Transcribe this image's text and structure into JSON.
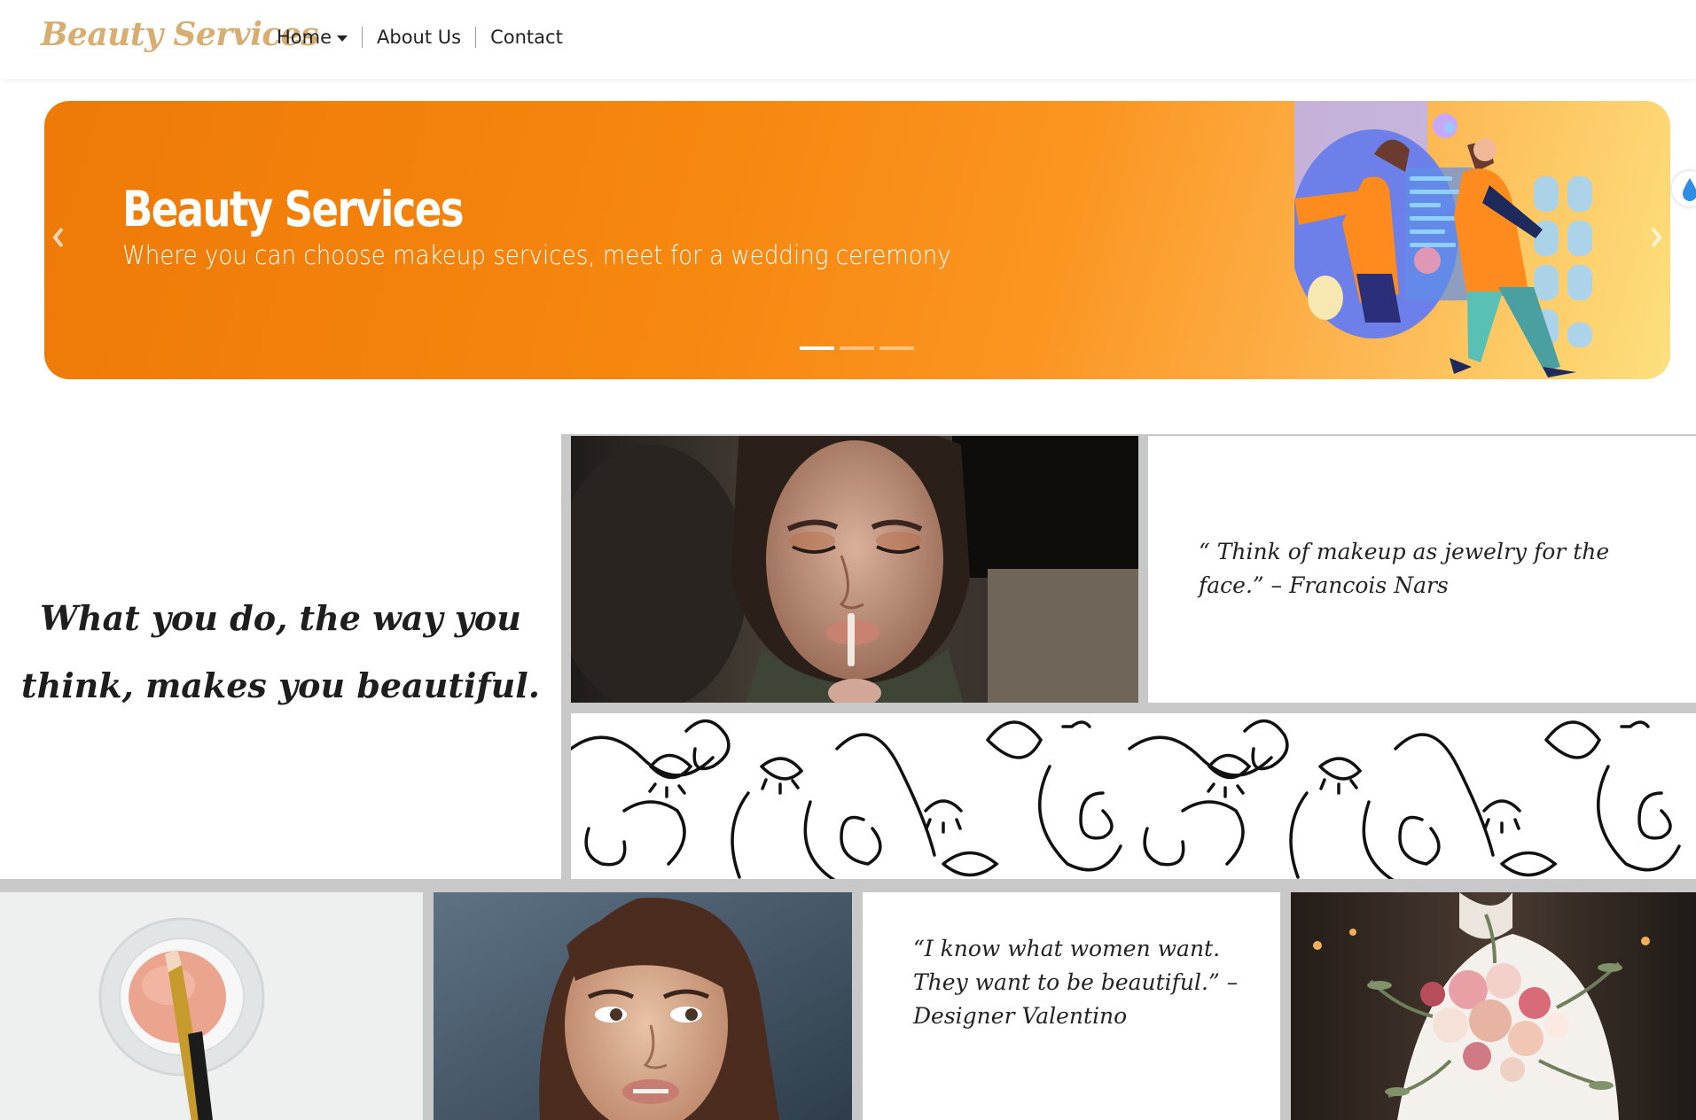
{
  "brand": {
    "name": "Beauty Services",
    "color": "#d8ad72"
  },
  "nav": {
    "items": [
      {
        "label": "Home",
        "has_dropdown": true
      },
      {
        "label": "About Us",
        "has_dropdown": false
      },
      {
        "label": "Contact",
        "has_dropdown": false
      }
    ]
  },
  "hero": {
    "title": "Beauty Services",
    "subtitle": "Where you can choose makeup services, meet for a wedding ceremony",
    "slide_count": 3,
    "active_slide": 1,
    "gradient": [
      "#ee7a07",
      "#fde07e"
    ]
  },
  "gallery": {
    "main_quote": "What you do, the way you think, makes you beautiful.",
    "quote_1": "“ Think of makeup as jewelry for the face.” – Francois Nars",
    "quote_2": "“I know what women want. They want to be beautiful.” – Designer Valentino",
    "images": [
      "woman-applying-lip-gloss-photo",
      "line-art-faces-pattern",
      "makeup-powder-brush-photo",
      "woman-portrait-photo",
      "bridal-bouquet-photo"
    ]
  }
}
